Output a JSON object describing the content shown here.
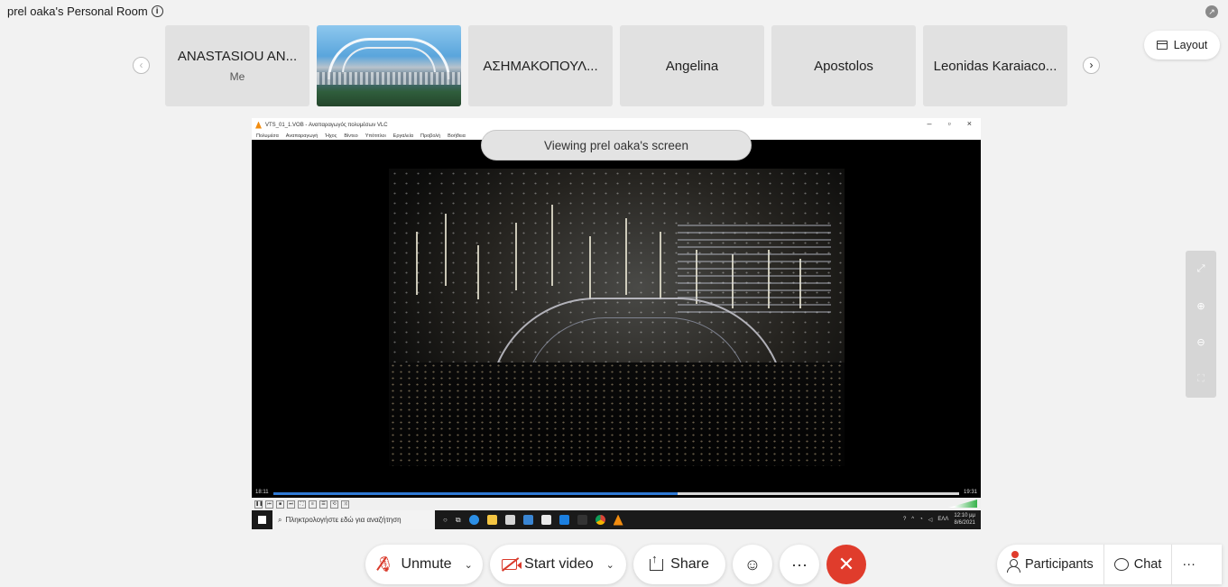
{
  "room": {
    "title": "prel oaka's Personal Room",
    "info_icon": "i"
  },
  "top_right_icon": "↗",
  "layout_button": {
    "label": "Layout"
  },
  "participants_strip": {
    "prev_arrow": "‹",
    "next_arrow": "›",
    "tiles": [
      {
        "name": "ANASTASIOU AN...",
        "sub": "Me"
      },
      {
        "name": "",
        "sub": ""
      },
      {
        "name": "ΑΣΗΜΑΚΟΠΟΥΛ...",
        "sub": ""
      },
      {
        "name": "Angelina",
        "sub": ""
      },
      {
        "name": "Apostolos",
        "sub": ""
      },
      {
        "name": "Leonidas Karaiaco...",
        "sub": ""
      }
    ]
  },
  "shared_screen": {
    "banner": "Viewing prel oaka's screen",
    "vlc": {
      "title": "VTS_01_1.VOB - Αναπαραγωγός πολυμέσων VLC",
      "menu": [
        "Πολυμέσα",
        "Αναπαραγωγή",
        "Ήχος",
        "Βίντεο",
        "Υπότιτλοι",
        "Εργαλεία",
        "Προβολή",
        "Βοήθεια"
      ],
      "win_min": "–",
      "win_max": "▫",
      "win_close": "×",
      "time_elapsed": "18:11",
      "time_total": "19:31",
      "progress": 0.59,
      "volume": "100%"
    },
    "taskbar": {
      "search_placeholder": "Πληκτρολογήστε εδώ για αναζήτηση",
      "language": "ΕΛΛ",
      "time": "12:10 μμ",
      "date": "8/6/2021"
    }
  },
  "zoom_controls": {
    "expand": "⤢",
    "zoom_in": "⊕",
    "zoom_out": "⊖",
    "fit": "⛶"
  },
  "controls": {
    "unmute_label": "Unmute",
    "start_video_label": "Start video",
    "share_label": "Share",
    "reactions_icon": "☺",
    "more_label": "···",
    "end_icon": "✕",
    "participants_label": "Participants",
    "chat_label": "Chat",
    "overflow_label": "···",
    "chevron": "⌄"
  },
  "colors": {
    "end_red": "#e03c2c",
    "muted_red": "#d93a2b",
    "vlc_progress": "#2f7ad6"
  }
}
